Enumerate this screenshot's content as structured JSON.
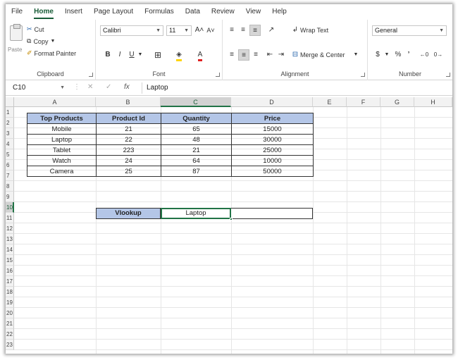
{
  "ribbon": {
    "tabs": [
      "File",
      "Home",
      "Insert",
      "Page Layout",
      "Formulas",
      "Data",
      "Review",
      "View",
      "Help"
    ],
    "active_tab": "Home",
    "clipboard": {
      "paste": "Paste",
      "cut": "Cut",
      "copy": "Copy",
      "format_painter": "Format Painter",
      "label": "Clipboard"
    },
    "font": {
      "name": "Calibri",
      "size": "11",
      "grow": "A˄",
      "shrink": "A˅",
      "bold": "B",
      "italic": "I",
      "underline": "U",
      "label": "Font"
    },
    "alignment": {
      "wrap_text": "Wrap Text",
      "merge_center": "Merge & Center",
      "label": "Alignment"
    },
    "number": {
      "format": "General",
      "currency": "$",
      "percent": "%",
      "comma": "’",
      "label": "Number"
    }
  },
  "formula_bar": {
    "name_box": "C10",
    "fx": "fx",
    "value": "Laptop"
  },
  "columns": [
    "A",
    "B",
    "C",
    "D",
    "E",
    "F",
    "G",
    "H"
  ],
  "selected_column": "C",
  "rows": [
    "1",
    "2",
    "3",
    "4",
    "5",
    "6",
    "7",
    "8",
    "9",
    "10",
    "11",
    "12",
    "13",
    "14",
    "15",
    "16",
    "17",
    "18",
    "19",
    "20",
    "21",
    "22",
    "23"
  ],
  "selected_row": "10",
  "table": {
    "headers": [
      "Top Products",
      "Product Id",
      "Quantity",
      "Price"
    ],
    "rows": [
      [
        "Mobile",
        "21",
        "65",
        "15000"
      ],
      [
        "Laptop",
        "22",
        "48",
        "30000"
      ],
      [
        "Tablet",
        "223",
        "21",
        "25000"
      ],
      [
        "Watch",
        "24",
        "64",
        "10000"
      ],
      [
        "Camera",
        "25",
        "87",
        "50000"
      ]
    ]
  },
  "vlookup": {
    "label": "Vlookup",
    "value": "Laptop",
    "result": ""
  },
  "colors": {
    "accent": "#217346",
    "header_fill": "#b4c6e7"
  }
}
